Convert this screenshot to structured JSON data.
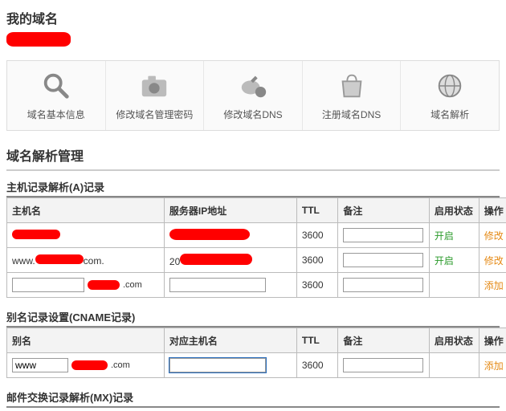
{
  "page_title": "我的域名",
  "toolbar": {
    "items": [
      {
        "label": "域名基本信息",
        "icon": "magnifier-icon"
      },
      {
        "label": "修改域名管理密码",
        "icon": "camera-icon"
      },
      {
        "label": "修改域名DNS",
        "icon": "dns-edit-icon"
      },
      {
        "label": "注册域名DNS",
        "icon": "bag-icon"
      },
      {
        "label": "域名解析",
        "icon": "globe-icon"
      }
    ]
  },
  "section_dns_mgmt": "域名解析管理",
  "a_section": {
    "title": "主机记录解析(A)记录",
    "headers": {
      "host": "主机名",
      "ip": "服务器IP地址",
      "ttl": "TTL",
      "note": "备注",
      "status": "启用状态",
      "op": "操作"
    },
    "rows": [
      {
        "host_prefix": "",
        "host_suffix": "",
        "ip_text": "",
        "ttl": "3600",
        "note": "",
        "status": "开启",
        "action": "修改"
      },
      {
        "host_prefix": "www.",
        "host_suffix": "com.",
        "ip_text": "20",
        "ttl": "3600",
        "note": "",
        "status": "开启",
        "action": "修改"
      }
    ],
    "add_row": {
      "host_value": "",
      "host_suffix": ".com",
      "ip_value": "",
      "ttl": "3600",
      "note": "",
      "action": "添加"
    }
  },
  "cname_section": {
    "title": "别名记录设置(CNAME记录)",
    "headers": {
      "alias": "别名",
      "target": "对应主机名",
      "ttl": "TTL",
      "note": "备注",
      "status": "启用状态",
      "op": "操作"
    },
    "add_row": {
      "alias_value": "www",
      "alias_suffix": ".com",
      "target_value": "",
      "ttl": "3600",
      "note": "",
      "action": "添加"
    }
  },
  "mx_section": {
    "title": "邮件交换记录解析(MX)记录"
  }
}
